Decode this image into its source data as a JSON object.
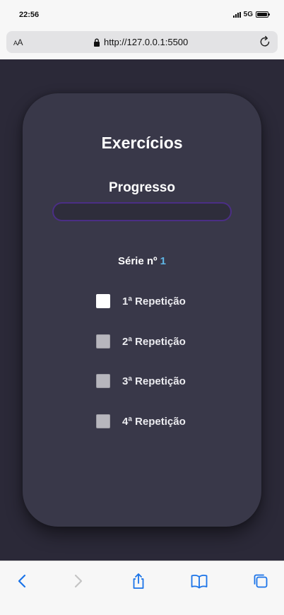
{
  "status_bar": {
    "time": "22:56",
    "network": "5G"
  },
  "browser": {
    "aa_large": "A",
    "aa_small": "A",
    "url": "http://127.0.0.1:5500"
  },
  "app": {
    "title": "Exercícios",
    "progress_label": "Progresso",
    "progress_value": 0,
    "serie_label": "Série nº",
    "serie_number": "1",
    "repetitions": [
      {
        "label": "1ª Repetição",
        "active": true
      },
      {
        "label": "2ª Repetição",
        "active": false
      },
      {
        "label": "3ª Repetição",
        "active": false
      },
      {
        "label": "4ª Repetição",
        "active": false
      }
    ]
  },
  "colors": {
    "page_bg": "#2b2938",
    "card_bg": "#393849",
    "progress_border": "#4b2e85",
    "serie_number": "#5fb6e6",
    "toolbar_icon_active": "#1a73e8",
    "toolbar_icon_disabled": "#c4c4c4"
  },
  "toolbar": {
    "icons": [
      "back-chevron-icon",
      "forward-chevron-icon",
      "share-icon",
      "bookmarks-icon",
      "tabs-icon"
    ]
  }
}
